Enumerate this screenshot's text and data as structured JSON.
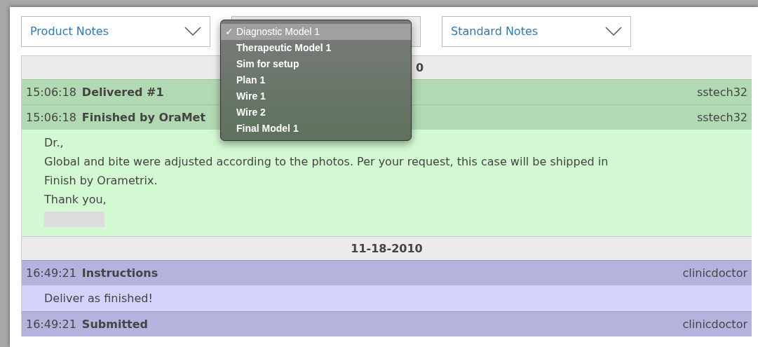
{
  "filters": [
    {
      "kind": "select",
      "label": "Product Notes"
    },
    {
      "kind": "covered"
    },
    {
      "kind": "select",
      "label": "Standard Notes"
    }
  ],
  "dropdown_menu": [
    {
      "label": "Diagnostic Model 1",
      "selected": true,
      "check": "✓"
    },
    {
      "label": "Therapeutic Model 1",
      "selected": false
    },
    {
      "label": "Sim for setup",
      "selected": false
    },
    {
      "label": "Plan 1",
      "selected": false
    },
    {
      "label": "Wire 1",
      "selected": false
    },
    {
      "label": "Wire 2",
      "selected": false
    },
    {
      "label": "Final Model 1",
      "selected": false
    }
  ],
  "sections": [
    {
      "date": "0",
      "partial": true,
      "entries": [
        {
          "kind": "lab",
          "time": "15:06:18",
          "title": "Delivered #1",
          "user": "sstech32"
        },
        {
          "kind": "lab",
          "time": "15:06:18",
          "title": "Finished by OraMet",
          "user": "sstech32",
          "body": [
            "Dr.,",
            "Global and bite were adjusted according to the photos. Per your request, this case will be shipped in Finish by Orametrix.",
            "Thank you,"
          ],
          "redacted_signature": true
        }
      ]
    },
    {
      "date": "11-18-2010",
      "partial": false,
      "entries": [
        {
          "kind": "clinic",
          "time": "16:49:21",
          "title": "Instructions",
          "user": "clinicdoctor",
          "body": [
            "Deliver as finished!"
          ]
        },
        {
          "kind": "clinic",
          "time": "16:49:21",
          "title": "Submitted",
          "user": "clinicdoctor"
        }
      ]
    }
  ]
}
